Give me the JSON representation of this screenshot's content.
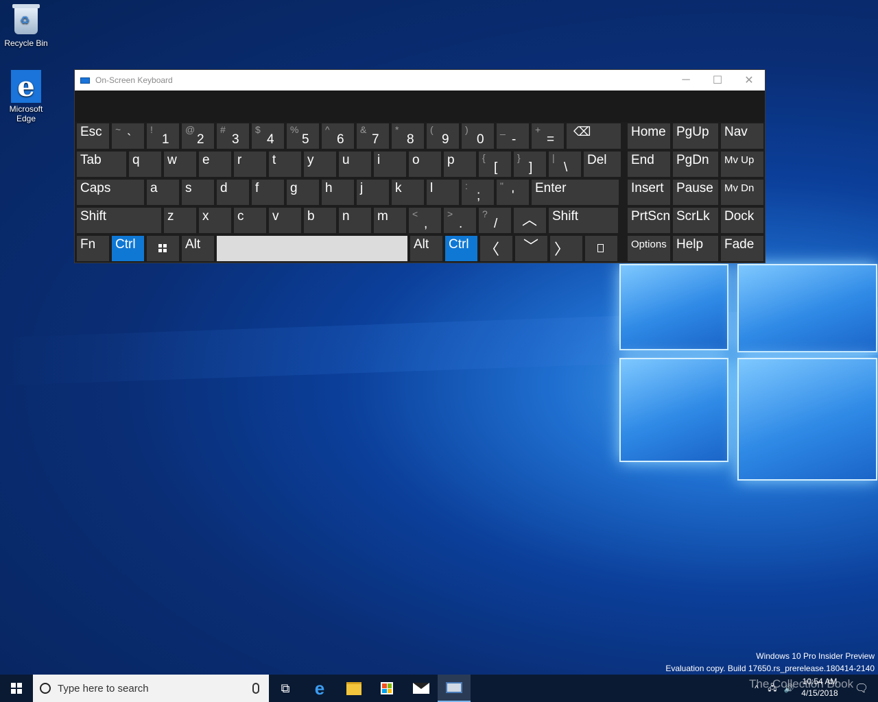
{
  "desktop": {
    "icons": [
      {
        "label": "Recycle Bin",
        "icon": "recycle-bin-icon"
      },
      {
        "label": "Microsoft Edge",
        "icon": "edge-icon"
      }
    ],
    "watermark_line1": "Windows 10 Pro Insider Preview",
    "watermark_line2": "Evaluation copy. Build 17650.rs_prerelease.180414-2140",
    "collection_watermark": "The Collection Book"
  },
  "osk": {
    "title": "On-Screen Keyboard",
    "controls": {
      "minimize": "─",
      "maximize": "☐",
      "close": "✕"
    },
    "keys": {
      "esc": "Esc",
      "tab": "Tab",
      "caps": "Caps",
      "shift": "Shift",
      "fn": "Fn",
      "ctrl": "Ctrl",
      "alt": "Alt",
      "del": "Del",
      "enter": "Enter",
      "shift_r": "Shift",
      "alt_r": "Alt",
      "ctrl_r": "Ctrl",
      "home": "Home",
      "pgup": "PgUp",
      "nav": "Nav",
      "end": "End",
      "pgdn": "PgDn",
      "mvup": "Mv Up",
      "insert": "Insert",
      "pause": "Pause",
      "mvdn": "Mv Dn",
      "prtscn": "PrtScn",
      "scrlk": "ScrLk",
      "dock": "Dock",
      "options": "Options",
      "help": "Help",
      "fade": "Fade",
      "row1": [
        {
          "s": "~",
          "m": "`"
        },
        {
          "s": "!",
          "m": "1"
        },
        {
          "s": "@",
          "m": "2"
        },
        {
          "s": "#",
          "m": "3"
        },
        {
          "s": "$",
          "m": "4"
        },
        {
          "s": "%",
          "m": "5"
        },
        {
          "s": "^",
          "m": "6"
        },
        {
          "s": "&",
          "m": "7"
        },
        {
          "s": "*",
          "m": "8"
        },
        {
          "s": "(",
          "m": "9"
        },
        {
          "s": ")",
          "m": "0"
        },
        {
          "s": "_",
          "m": "-"
        },
        {
          "s": "+",
          "m": "="
        }
      ],
      "row2": [
        "q",
        "w",
        "e",
        "r",
        "t",
        "y",
        "u",
        "i",
        "o",
        "p"
      ],
      "row2_sym": [
        {
          "s": "{",
          "m": "["
        },
        {
          "s": "}",
          "m": "]"
        },
        {
          "s": "|",
          "m": "\\"
        }
      ],
      "row3": [
        "a",
        "s",
        "d",
        "f",
        "g",
        "h",
        "j",
        "k",
        "l"
      ],
      "row3_sym": [
        {
          "s": ":",
          "m": ";"
        },
        {
          "s": "\"",
          "m": "'"
        }
      ],
      "row4": [
        "z",
        "x",
        "c",
        "v",
        "b",
        "n",
        "m"
      ],
      "row4_sym": [
        {
          "s": "<",
          "m": ","
        },
        {
          "s": ">",
          "m": "."
        },
        {
          "s": "?",
          "m": "/"
        }
      ]
    },
    "colors": {
      "key": "#3a3a3a",
      "accent": "#0f78d4",
      "space": "#dcdcdc"
    }
  },
  "taskbar": {
    "search_placeholder": "Type here to search",
    "time": "10:54 AM",
    "date": "4/15/2018"
  }
}
